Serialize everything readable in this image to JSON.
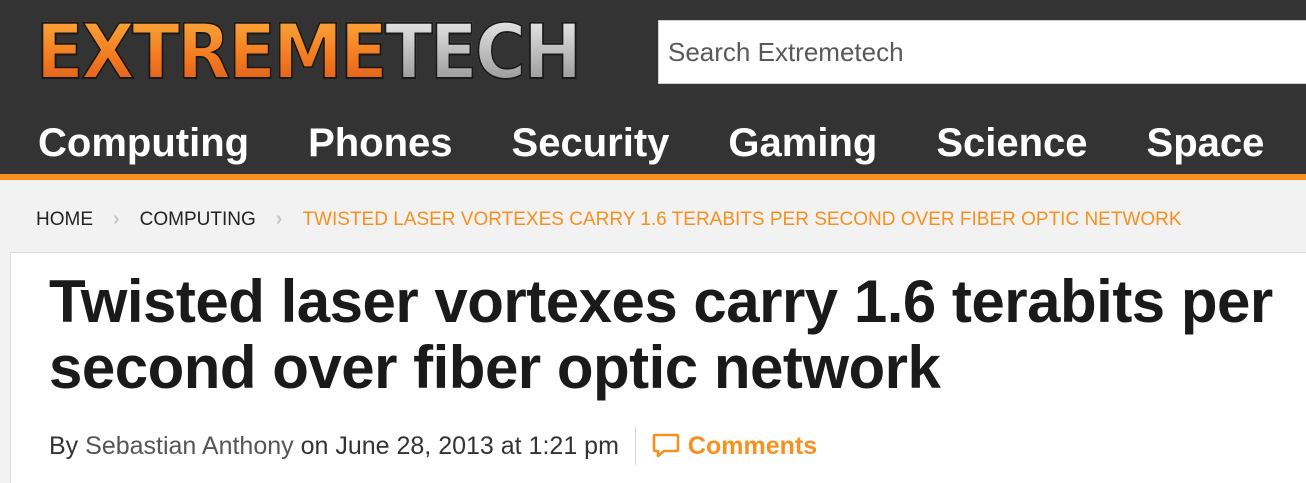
{
  "brand": {
    "logo_part1": "EXTREME",
    "logo_part2": "TECH",
    "accent_color": "#f7901e",
    "header_color": "#333333"
  },
  "search": {
    "placeholder": "Search Extremetech",
    "value": ""
  },
  "nav": {
    "items": [
      {
        "label": "Computing"
      },
      {
        "label": "Phones"
      },
      {
        "label": "Security"
      },
      {
        "label": "Gaming"
      },
      {
        "label": "Science"
      },
      {
        "label": "Space"
      }
    ]
  },
  "breadcrumb": {
    "items": [
      {
        "label": "HOME"
      },
      {
        "label": "COMPUTING"
      },
      {
        "label": "TWISTED LASER VORTEXES CARRY 1.6 TERABITS PER SECOND OVER FIBER OPTIC NETWORK"
      }
    ],
    "separator": "›"
  },
  "article": {
    "title": "Twisted laser vortexes carry 1.6 terabits per second over fiber optic network",
    "byline_prefix": "By",
    "author": "Sebastian Anthony",
    "date_text": "on June 28, 2013 at 1:21 pm",
    "comments_label": "Comments",
    "comments_icon": "speech-bubble-icon"
  }
}
